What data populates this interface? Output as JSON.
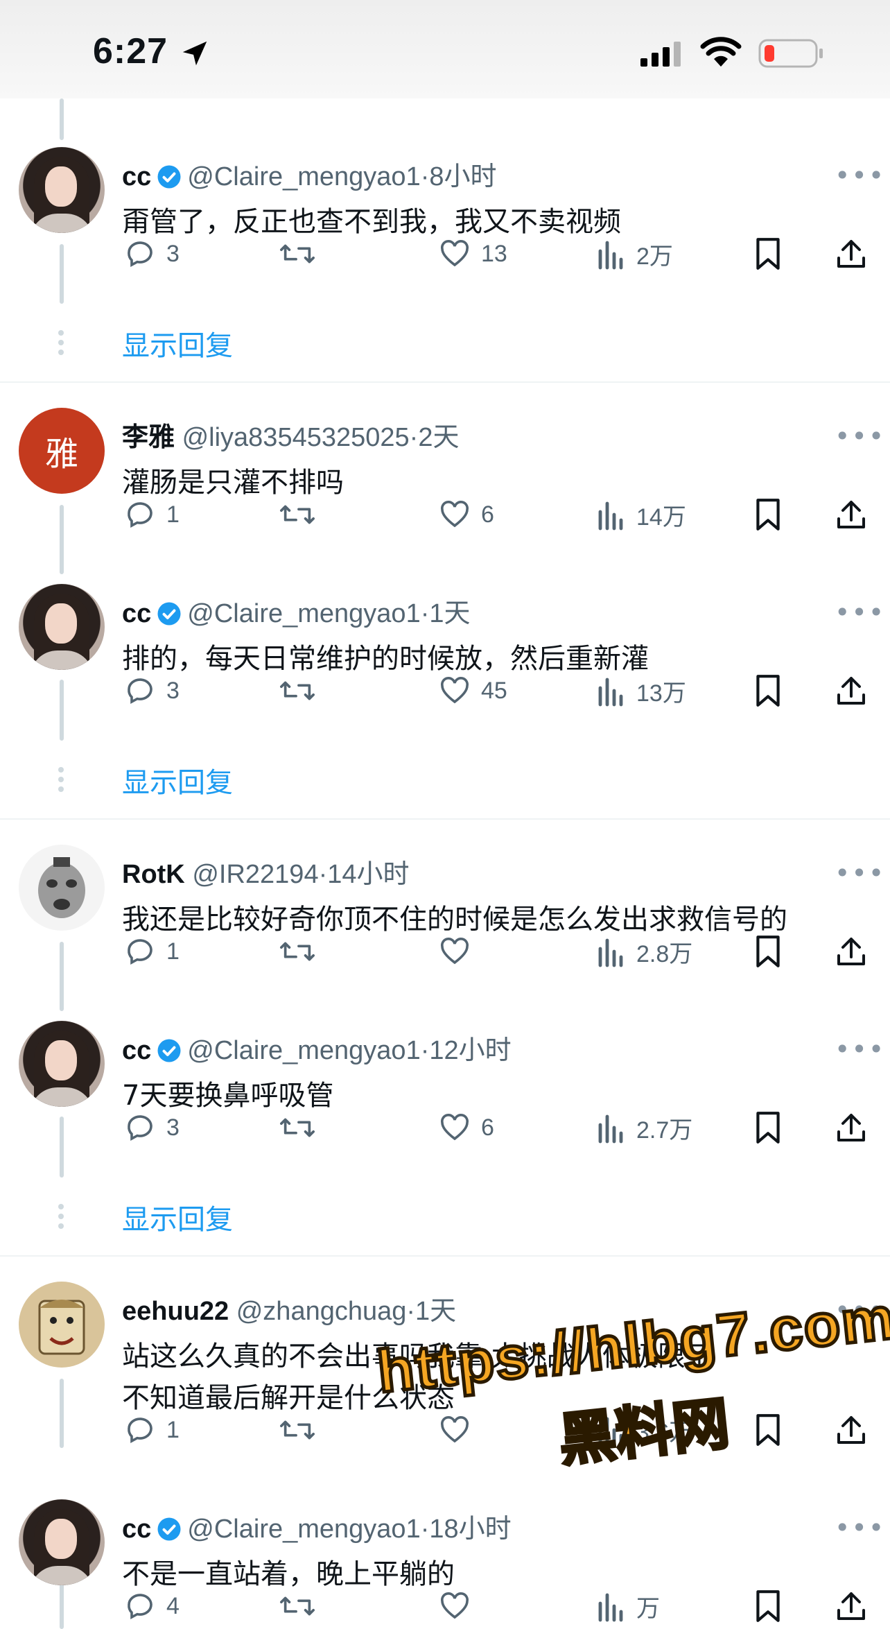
{
  "status": {
    "time": "6:27"
  },
  "colors": {
    "link": "#1d9bf0",
    "muted": "#536471",
    "verified": "#1d9bf0",
    "watermark": "#f5a623",
    "battery_low": "#ff3b30"
  },
  "show_replies_label": "显示回复",
  "tweets": [
    {
      "name": "cc",
      "handle": "@Claire_mengyao1",
      "dot": "·",
      "time": "8小时",
      "text": "甭管了，反正也查不到我，我又不卖视频",
      "replies": "3",
      "likes": "13",
      "views": "2万",
      "verified": true,
      "avatar": "cc-avatar"
    },
    {
      "name": "李雅",
      "handle": "@liya83545325025",
      "dot": "·",
      "time": "2天",
      "text": "灌肠是只灌不排吗",
      "replies": "1",
      "likes": "6",
      "views": "14万",
      "verified": false,
      "avatar_text": "雅"
    },
    {
      "name": "cc",
      "handle": "@Claire_mengyao1",
      "dot": "·",
      "time": "1天",
      "text": "排的，每天日常维护的时候放，然后重新灌",
      "replies": "3",
      "likes": "45",
      "views": "13万",
      "verified": true,
      "avatar": "cc-avatar"
    },
    {
      "name": "RotK",
      "handle": "@IR22194",
      "dot": "·",
      "time": "14小时",
      "text": "我还是比较好奇你顶不住的时候是怎么发出求救信号的",
      "replies": "1",
      "likes": "",
      "views": "2.8万",
      "verified": false,
      "avatar": "rotk-avatar"
    },
    {
      "name": "cc",
      "handle": "@Claire_mengyao1",
      "dot": "·",
      "time": "12小时",
      "text": "7天要换鼻呼吸管",
      "replies": "3",
      "likes": "6",
      "views": "2.7万",
      "verified": true,
      "avatar": "cc-avatar"
    },
    {
      "name": "eehuu22",
      "handle": "@zhangchuag",
      "dot": "·",
      "time": "1天",
      "text_lines": [
        "站这么久真的不会出事吗我靠 太挑战人体极限了",
        "不知道最后解开是什么状态"
      ],
      "replies": "1",
      "likes": "",
      "views": "3.6万",
      "verified": false,
      "avatar": "eehuu-avatar"
    },
    {
      "name": "cc",
      "handle": "@Claire_mengyao1",
      "dot": "·",
      "time": "18小时",
      "text": "不是一直站着，晚上平躺的",
      "replies": "4",
      "likes": "",
      "views": "万",
      "verified": true,
      "avatar": "cc-avatar"
    }
  ],
  "watermark": {
    "url": "https://hlbg7.com",
    "name": "黑料网"
  }
}
